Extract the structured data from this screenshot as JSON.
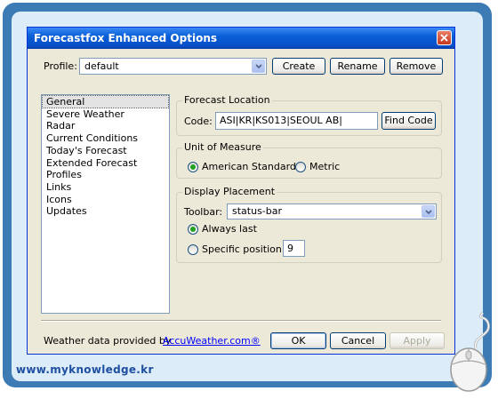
{
  "window": {
    "title": "Forecastfox Enhanced Options"
  },
  "profile": {
    "label": "Profile:",
    "value": "default",
    "create_label": "Create",
    "rename_label": "Rename",
    "remove_label": "Remove"
  },
  "nav": {
    "items": [
      "General",
      "Severe Weather",
      "Radar",
      "Current Conditions",
      "Today's Forecast",
      "Extended Forecast",
      "Profiles",
      "Links",
      "Icons",
      "Updates"
    ],
    "selected": "General"
  },
  "forecast_location": {
    "group_label": "Forecast Location",
    "code_label": "Code:",
    "code_value": "ASI|KR|KS013|SEOUL AB|",
    "find_label": "Find Code"
  },
  "unit_of_measure": {
    "group_label": "Unit of Measure",
    "options": [
      "American Standard",
      "Metric"
    ],
    "selected": "American Standard"
  },
  "display_placement": {
    "group_label": "Display Placement",
    "toolbar_label": "Toolbar:",
    "toolbar_value": "status-bar",
    "always_last_label": "Always last",
    "specific_label": "Specific position:",
    "position_value": "9",
    "selected": "Always last"
  },
  "footer": {
    "provider_text": "Weather data provided by",
    "provider_link": "AccuWeather.com®",
    "ok_label": "OK",
    "cancel_label": "Cancel",
    "apply_label": "Apply"
  },
  "watermark": {
    "text": "www.myknowledge.kr"
  },
  "colors": {
    "titlebar": "#0a5fd6",
    "frame": "#3d7bb5",
    "radio_dot": "#21a121",
    "link": "#0000ff"
  }
}
